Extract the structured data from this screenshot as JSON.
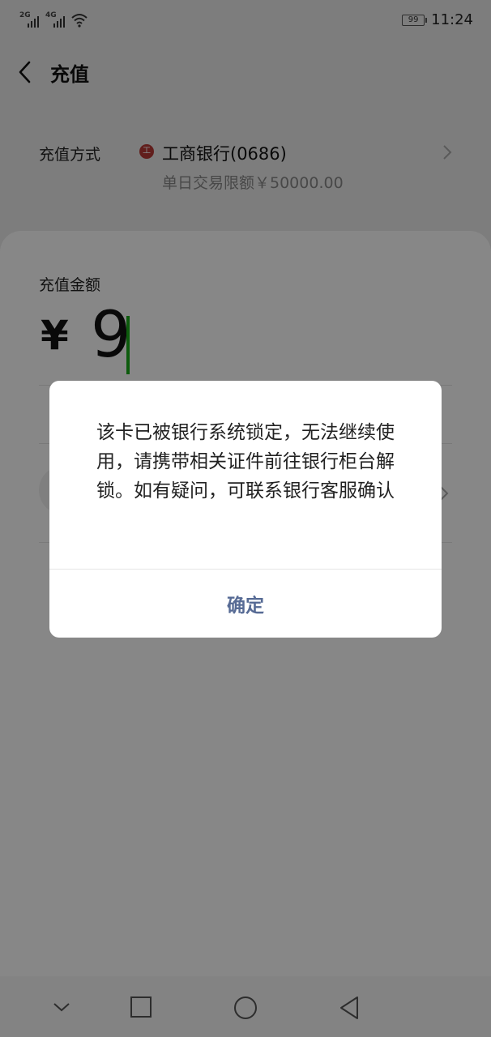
{
  "status_bar": {
    "signal_1_label": "2G",
    "signal_2_label": "4G",
    "battery": "99",
    "time": "11:24"
  },
  "header": {
    "title": "充值"
  },
  "payment_method": {
    "label": "充值方式",
    "bank_icon_glyph": "工",
    "bank_name": "工商银行(0686)",
    "limit": "单日交易限额￥50000.00"
  },
  "amount": {
    "label": "充值金额",
    "currency": "¥",
    "value": "9"
  },
  "dialog": {
    "message": "该卡已被银行系统锁定，无法继续使用，请携带相关证件前往银行柜台解锁。如有疑问，可联系银行客服确认",
    "confirm_label": "确定"
  },
  "colors": {
    "cursor": "#1aad19",
    "dialog_button": "#576b95",
    "bank_icon": "#b83a36"
  },
  "icons": [
    "back-arrow-icon",
    "bank-icon",
    "chevron-right-icon",
    "wifi-icon",
    "nav-back-icon",
    "nav-home-icon",
    "nav-recents-icon",
    "nav-collapse-icon"
  ]
}
